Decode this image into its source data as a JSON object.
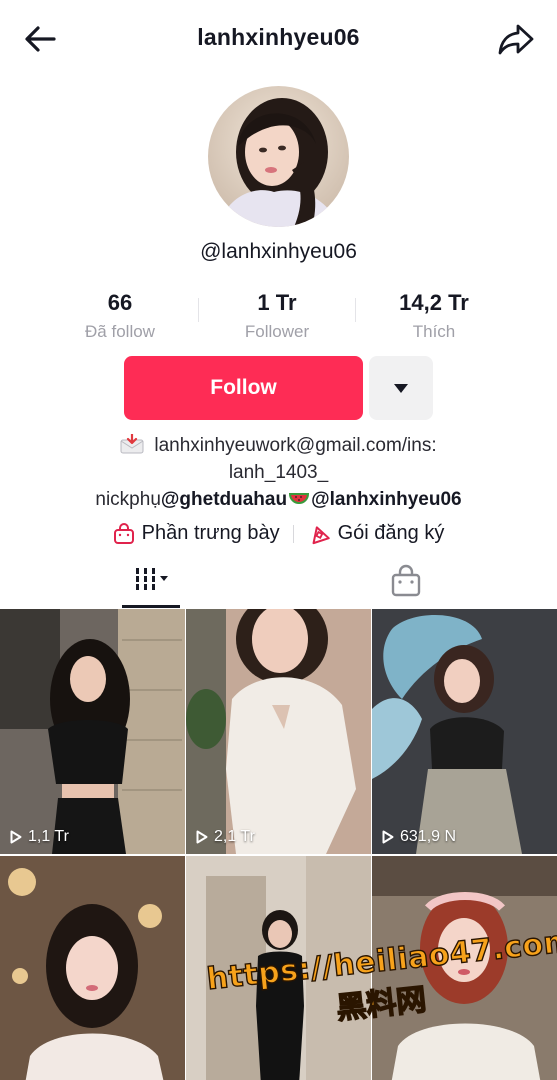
{
  "header": {
    "title": "lanhxinhyeu06",
    "back_icon": "back-arrow-icon",
    "share_icon": "share-icon"
  },
  "profile": {
    "handle": "@lanhxinhyeu06"
  },
  "stats": [
    {
      "value": "66",
      "label": "Đã follow"
    },
    {
      "value": "1 Tr",
      "label": "Follower"
    },
    {
      "value": "14,2 Tr",
      "label": "Thích"
    }
  ],
  "actions": {
    "follow_label": "Follow",
    "more_icon": "caret-down-icon",
    "accent": "#fe2c55"
  },
  "bio": {
    "line1": "lanhxinhyeuwork@gmail.com/ins:",
    "line2": "lanh_1403_",
    "line3_prefix": "nickphụ",
    "line3_mention1": "@ghetduahau",
    "line3_mention2": "@lanhxinhyeu06"
  },
  "links": [
    {
      "label": "Phần trưng bày",
      "icon": "bag-icon"
    },
    {
      "label": "Gói đăng ký",
      "icon": "subscription-icon"
    }
  ],
  "tabs": [
    {
      "name": "videos",
      "icon": "grid-icon",
      "active": true
    },
    {
      "name": "shop",
      "icon": "shop-bag-icon",
      "active": false
    }
  ],
  "videos": [
    {
      "views": "1,1 Tr"
    },
    {
      "views": "2,1 Tr"
    },
    {
      "views": "631,9 N"
    },
    {
      "views": ""
    },
    {
      "views": ""
    },
    {
      "views": ""
    }
  ],
  "watermark": {
    "url": "https://heiliao47.com",
    "cn": "黑料网"
  }
}
